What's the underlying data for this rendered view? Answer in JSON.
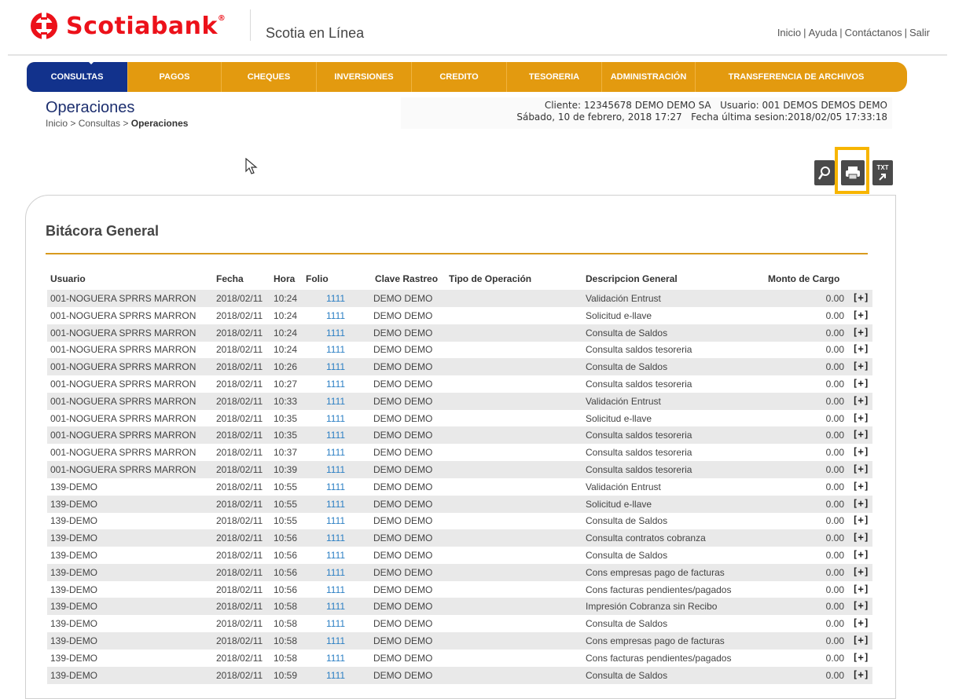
{
  "brand": {
    "name": "Scotiabank",
    "reg": "®",
    "app_title": "Scotia en Línea"
  },
  "top_links": [
    "Inicio",
    "Ayuda",
    "Contáctanos",
    "Salir"
  ],
  "nav": [
    "CONSULTAS",
    "PAGOS",
    "CHEQUES",
    "INVERSIONES",
    "CREDITO",
    "TESORERIA",
    "ADMINISTRACIÓN",
    "TRANSFERENCIA DE ARCHIVOS"
  ],
  "page": {
    "title": "Operaciones",
    "breadcrumb_prefix": "Inicio > Consultas > ",
    "breadcrumb_current": "Operaciones"
  },
  "client_info": {
    "line1": "Cliente: 12345678 DEMO DEMO SA   Usuario: 001 DEMOS DEMOS DEMO",
    "line2": "Sábado, 10 de febrero, 2018 17:27   Fecha última sesion:2018/02/05 17:33:18"
  },
  "toolbar": {
    "search_icon": "search-icon",
    "print_icon": "print-icon",
    "txt_label": "TXT"
  },
  "section_title": "Bitácora General",
  "table": {
    "headers": [
      "Usuario",
      "Fecha",
      "Hora",
      "Folio",
      "Clave Rastreo",
      "Tipo de Operación",
      "Descripcion General",
      "Monto de Cargo"
    ],
    "rows": [
      [
        "001-NOGUERA SPRRS MARRON",
        "2018/02/11",
        "10:24",
        "1111",
        "DEMO DEMO",
        "",
        "Validación Entrust",
        "0.00"
      ],
      [
        "001-NOGUERA SPRRS MARRON",
        "2018/02/11",
        "10:24",
        "1111",
        "DEMO DEMO",
        "",
        "Solicitud e-llave",
        "0.00"
      ],
      [
        "001-NOGUERA SPRRS MARRON",
        "2018/02/11",
        "10:24",
        "1111",
        "DEMO DEMO",
        "",
        "Consulta de Saldos",
        "0.00"
      ],
      [
        "001-NOGUERA SPRRS MARRON",
        "2018/02/11",
        "10:24",
        "1111",
        "DEMO DEMO",
        "",
        "Consulta saldos tesoreria",
        "0.00"
      ],
      [
        "001-NOGUERA SPRRS MARRON",
        "2018/02/11",
        "10:26",
        "1111",
        "DEMO DEMO",
        "",
        "Consulta de Saldos",
        "0.00"
      ],
      [
        "001-NOGUERA SPRRS MARRON",
        "2018/02/11",
        "10:27",
        "1111",
        "DEMO DEMO",
        "",
        "Consulta saldos tesoreria",
        "0.00"
      ],
      [
        "001-NOGUERA SPRRS MARRON",
        "2018/02/11",
        "10:33",
        "1111",
        "DEMO DEMO",
        "",
        "Validación Entrust",
        "0.00"
      ],
      [
        "001-NOGUERA SPRRS MARRON",
        "2018/02/11",
        "10:35",
        "1111",
        "DEMO DEMO",
        "",
        "Solicitud e-llave",
        "0.00"
      ],
      [
        "001-NOGUERA SPRRS MARRON",
        "2018/02/11",
        "10:35",
        "1111",
        "DEMO DEMO",
        "",
        "Consulta saldos tesoreria",
        "0.00"
      ],
      [
        "001-NOGUERA SPRRS MARRON",
        "2018/02/11",
        "10:37",
        "1111",
        "DEMO DEMO",
        "",
        "Consulta saldos tesoreria",
        "0.00"
      ],
      [
        "001-NOGUERA SPRRS MARRON",
        "2018/02/11",
        "10:39",
        "1111",
        "DEMO DEMO",
        "",
        "Consulta saldos tesoreria",
        "0.00"
      ],
      [
        "139-DEMO",
        "2018/02/11",
        "10:55",
        "1111",
        "DEMO DEMO",
        "",
        "Validación Entrust",
        "0.00"
      ],
      [
        "139-DEMO",
        "2018/02/11",
        "10:55",
        "1111",
        "DEMO DEMO",
        "",
        "Solicitud e-llave",
        "0.00"
      ],
      [
        "139-DEMO",
        "2018/02/11",
        "10:55",
        "1111",
        "DEMO DEMO",
        "",
        "Consulta de Saldos",
        "0.00"
      ],
      [
        "139-DEMO",
        "2018/02/11",
        "10:56",
        "1111",
        "DEMO DEMO",
        "",
        "Consulta contratos cobranza",
        "0.00"
      ],
      [
        "139-DEMO",
        "2018/02/11",
        "10:56",
        "1111",
        "DEMO DEMO",
        "",
        "Consulta de Saldos",
        "0.00"
      ],
      [
        "139-DEMO",
        "2018/02/11",
        "10:56",
        "1111",
        "DEMO DEMO",
        "",
        "Cons empresas pago de facturas",
        "0.00"
      ],
      [
        "139-DEMO",
        "2018/02/11",
        "10:56",
        "1111",
        "DEMO DEMO",
        "",
        "Cons facturas pendientes/pagados",
        "0.00"
      ],
      [
        "139-DEMO",
        "2018/02/11",
        "10:58",
        "1111",
        "DEMO DEMO",
        "",
        "Impresión Cobranza sin Recibo",
        "0.00"
      ],
      [
        "139-DEMO",
        "2018/02/11",
        "10:58",
        "1111",
        "DEMO DEMO",
        "",
        "Consulta de Saldos",
        "0.00"
      ],
      [
        "139-DEMO",
        "2018/02/11",
        "10:58",
        "1111",
        "DEMO DEMO",
        "",
        "Cons empresas pago de facturas",
        "0.00"
      ],
      [
        "139-DEMO",
        "2018/02/11",
        "10:58",
        "1111",
        "DEMO DEMO",
        "",
        "Cons facturas pendientes/pagados",
        "0.00"
      ],
      [
        "139-DEMO",
        "2018/02/11",
        "10:59",
        "1111",
        "DEMO DEMO",
        "",
        "Consulta de Saldos",
        "0.00"
      ]
    ],
    "expand_label": "[+]"
  },
  "colors": {
    "brand_red": "#ec111a",
    "nav_orange": "#e39a0f",
    "nav_active": "#12328c",
    "highlight": "#f7b500",
    "folio_link": "#2b7fc4"
  }
}
